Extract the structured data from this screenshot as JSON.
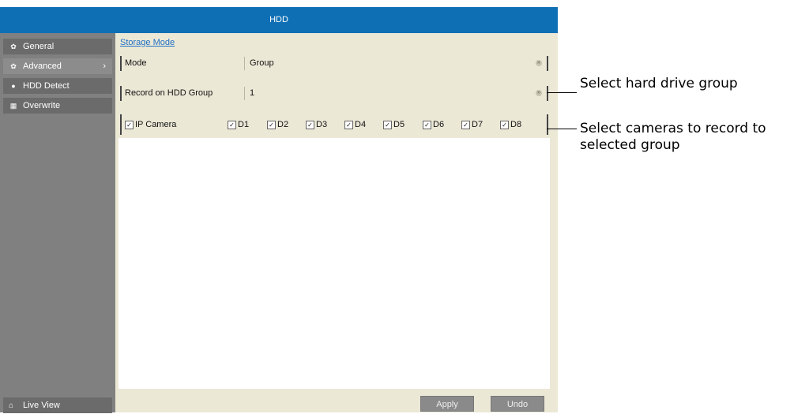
{
  "window": {
    "title": "HDD"
  },
  "sidebar": {
    "items": [
      {
        "label": "General",
        "icon": "gear-icon"
      },
      {
        "label": "Advanced",
        "icon": "gear-icon"
      },
      {
        "label": "HDD Detect",
        "icon": "hdd-detect-icon"
      },
      {
        "label": "Overwrite",
        "icon": "grid-icon"
      }
    ],
    "footer": {
      "label": "Live View",
      "icon": "home-icon"
    }
  },
  "main": {
    "heading": "Storage Mode",
    "mode": {
      "label": "Mode",
      "value": "Group"
    },
    "record_group": {
      "label": "Record on HDD Group",
      "value": "1"
    },
    "cameras": {
      "master_label": "IP Camera",
      "items": [
        "D1",
        "D2",
        "D3",
        "D4",
        "D5",
        "D6",
        "D7",
        "D8"
      ]
    },
    "buttons": {
      "apply": "Apply",
      "undo": "Undo"
    }
  },
  "callouts": {
    "hdd_group": "Select hard drive group",
    "cameras_line1": "Select cameras to record to",
    "cameras_line2": "selected group"
  },
  "colors": {
    "titlebar": "#0f6fb5",
    "link": "#1e6fc4",
    "panel": "#ece8d6",
    "sidebar": "#808080"
  }
}
